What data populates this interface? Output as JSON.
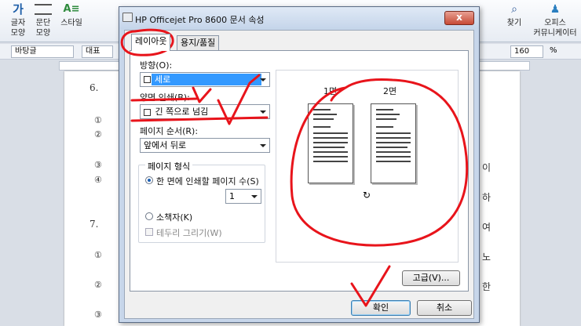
{
  "ribbon": {
    "buttons": [
      {
        "label1": "글자",
        "label2": "모양"
      },
      {
        "label1": "문단",
        "label2": "모양"
      },
      {
        "label1": "스타일",
        "label2": ""
      },
      {
        "label1": "찾기",
        "label2": ""
      },
      {
        "label1": "오피스",
        "label2": "커뮤니케이터"
      }
    ],
    "style_combo": "바탕글",
    "font_combo": "대표",
    "zoom_value": "160",
    "zoom_unit": "%"
  },
  "document": {
    "item6": "6.",
    "item7": "7.",
    "right_chars": [
      "이",
      "하",
      "여",
      "노",
      "한"
    ],
    "circle_nums": [
      "①",
      "②",
      "③",
      "④",
      "①",
      "②",
      "③"
    ]
  },
  "dialog": {
    "title": "HP Officejet Pro 8600 문서 속성",
    "close": "x",
    "tabs": [
      "레이아웃",
      "용지/품질"
    ],
    "orientation_label": "방향(O):",
    "orientation_value": "세로",
    "duplex_label": "양면 인쇄(B):",
    "duplex_value": "긴 쪽으로 넘김",
    "order_label": "페이지 순서(R):",
    "order_value": "앞에서 뒤로",
    "format_group": "페이지 형식",
    "pages_per_sheet_label": "한 면에 인쇄할 페이지 수(S)",
    "pages_per_sheet_value": "1",
    "booklet_label": "소책자(K)",
    "border_label": "테두리 그리기(W)",
    "preview_page1": "1면",
    "preview_page2": "2면",
    "advanced_button": "고급(V)...",
    "ok_button": "확인",
    "cancel_button": "취소"
  },
  "colors": {
    "annotation_red": "#e8141b",
    "selection_blue": "#3399ff"
  }
}
